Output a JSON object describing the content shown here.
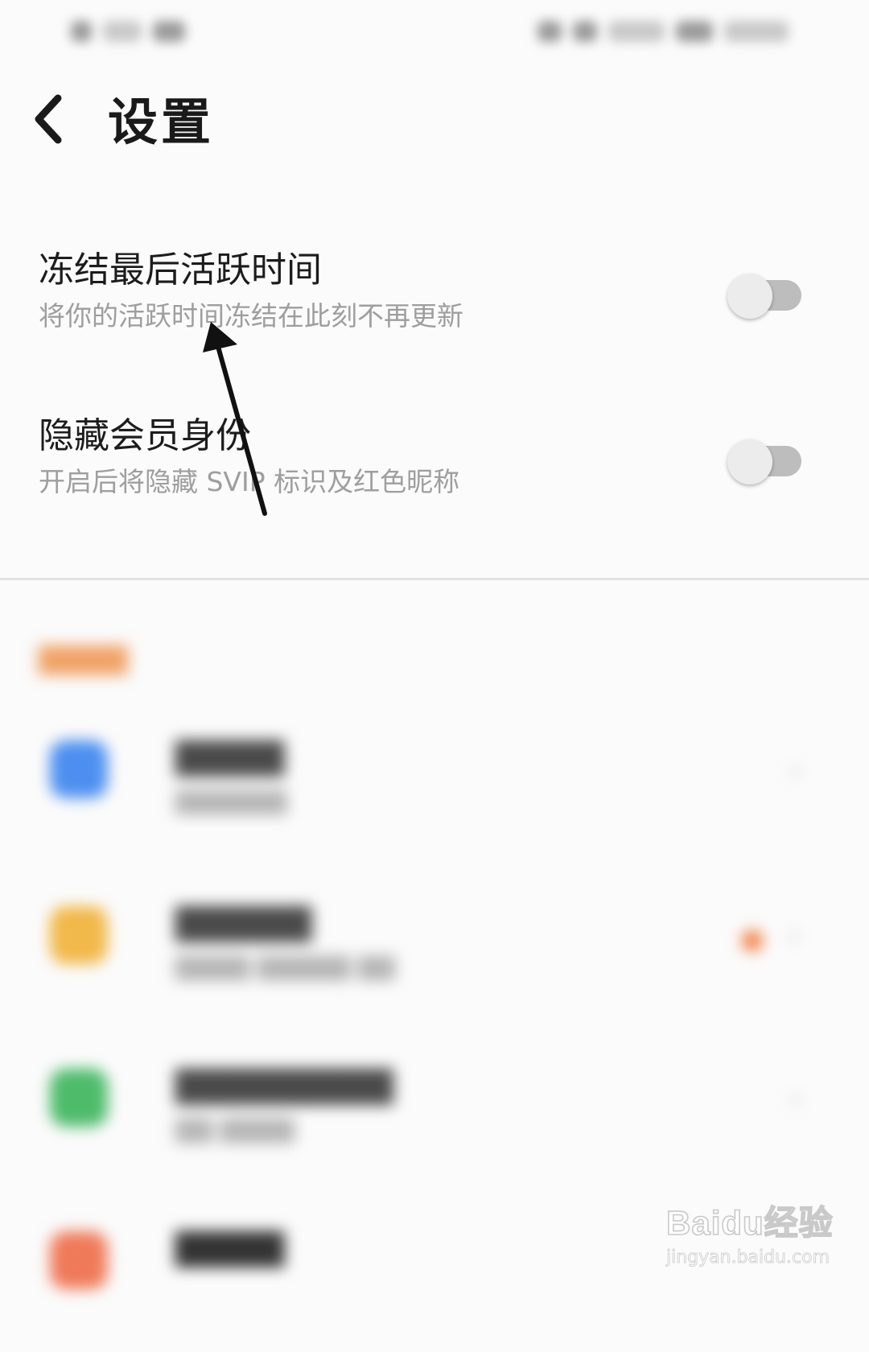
{
  "header": {
    "title": "设置"
  },
  "settings": [
    {
      "title": "冻结最后活跃时间",
      "description": "将你的活跃时间冻结在此刻不再更新",
      "enabled": false
    },
    {
      "title": "隐藏会员身份",
      "description": "开启后将隐藏 SVIP 标识及红色昵称",
      "enabled": false
    }
  ],
  "blurred_items": [
    {
      "icon_color": "#4d8ff0"
    },
    {
      "icon_color": "#f1b84a"
    },
    {
      "icon_color": "#4dbb6a"
    },
    {
      "icon_color": "#ef7a5a"
    }
  ],
  "watermark": {
    "brand": "Baidu经验",
    "url": "jingyan.baidu.com"
  },
  "colors": {
    "accent_section": "#f0a266",
    "toggle_track": "#bdbdbd",
    "toggle_knob": "#ececec"
  }
}
